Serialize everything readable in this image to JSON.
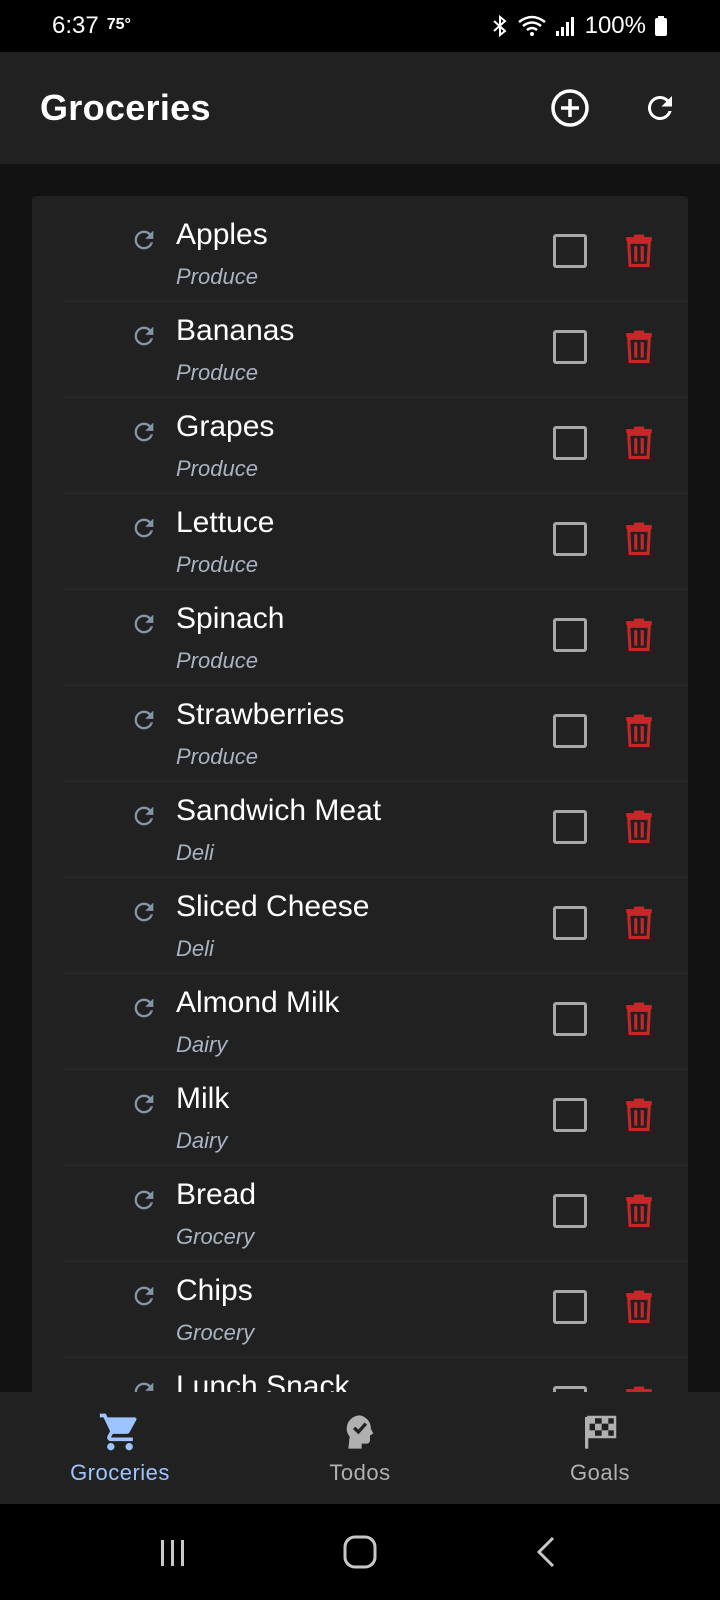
{
  "status_bar": {
    "time": "6:37",
    "temperature": "75°",
    "battery": "100%"
  },
  "app_bar": {
    "title": "Groceries",
    "add_icon": "add-circle-icon",
    "refresh_icon": "refresh-icon"
  },
  "items": [
    {
      "name": "Apples",
      "category": "Produce"
    },
    {
      "name": "Bananas",
      "category": "Produce"
    },
    {
      "name": "Grapes",
      "category": "Produce"
    },
    {
      "name": "Lettuce",
      "category": "Produce"
    },
    {
      "name": "Spinach",
      "category": "Produce"
    },
    {
      "name": "Strawberries",
      "category": "Produce"
    },
    {
      "name": "Sandwich Meat",
      "category": "Deli"
    },
    {
      "name": "Sliced Cheese",
      "category": "Deli"
    },
    {
      "name": "Almond Milk",
      "category": "Dairy"
    },
    {
      "name": "Milk",
      "category": "Dairy"
    },
    {
      "name": "Bread",
      "category": "Grocery"
    },
    {
      "name": "Chips",
      "category": "Grocery"
    },
    {
      "name": "Lunch Snack",
      "category": ""
    }
  ],
  "bottom_nav": [
    {
      "label": "Groceries",
      "icon": "cart-icon",
      "active": true
    },
    {
      "label": "Todos",
      "icon": "head-check-icon",
      "active": false
    },
    {
      "label": "Goals",
      "icon": "checkered-flag-icon",
      "active": false
    }
  ],
  "colors": {
    "accent": "#9ec4ff",
    "delete": "#c62828",
    "row_icon": "#8595a8"
  }
}
